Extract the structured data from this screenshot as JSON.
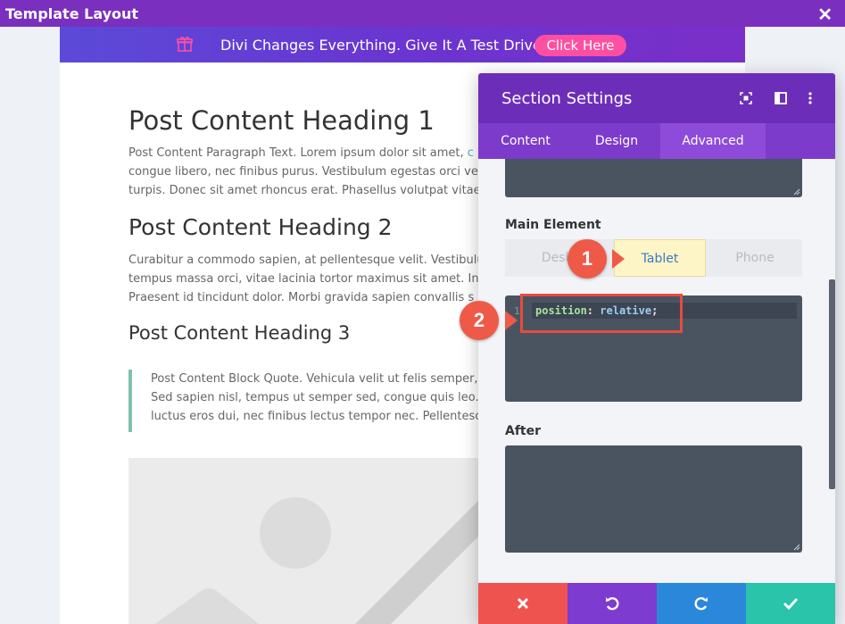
{
  "window": {
    "title": "Template Layout"
  },
  "promo": {
    "text": "Divi Changes Everything. Give It A Test Drive!",
    "cta": "Click Here"
  },
  "article": {
    "h1": "Post Content Heading 1",
    "p1": [
      "Post Content Paragraph Text. Lorem ipsum dolor sit amet,",
      "congue libero, nec finibus purus. Vestibulum egestas orci vel",
      "turpis. Donec sit amet rhoncus erat. Phasellus volutpat vitae"
    ],
    "p1_link": "c",
    "h2": "Post Content Heading 2",
    "p2": [
      "Curabitur a commodo sapien, at pellentesque velit. Vestibulu",
      "tempus massa orci, vitae lacinia tortor maximus sit amet. In",
      "Praesent id tincidunt dolor. Morbi gravida sapien convallis s"
    ],
    "h3": "Post Content Heading 3",
    "quote": [
      "Post Content Block Quote. Vehicula velit ut felis semper,",
      "Sed sapien nisl, tempus ut semper sed, congue quis leo.",
      "luctus eros dui, nec finibus lectus tempor nec. Pellentesc"
    ]
  },
  "panel": {
    "title": "Section Settings",
    "tabs": [
      "Content",
      "Design",
      "Advanced"
    ],
    "active_tab": "Advanced",
    "main_element_label": "Main Element",
    "device_tabs": [
      "Deskt",
      "Tablet",
      "Phone"
    ],
    "active_device": "Tablet",
    "code": {
      "line_number": "1",
      "property": "position",
      "colon": ":",
      "value": "relative",
      "semicolon": ";"
    },
    "after_label": "After"
  },
  "callouts": {
    "one": "1",
    "two": "2"
  },
  "colors": {
    "header_purple": "#6c2eb9",
    "cancel": "#ef5350",
    "undo": "#7e3bd0",
    "redo": "#2b87da",
    "save": "#29c4a9"
  },
  "icons": {
    "close": "close-icon",
    "gift": "gift-icon",
    "fullscreen": "fullscreen-icon",
    "layout": "split-view-icon",
    "more": "more-vertical-icon",
    "cancel": "close-icon",
    "undo": "undo-icon",
    "redo": "redo-icon",
    "save": "check-icon"
  }
}
